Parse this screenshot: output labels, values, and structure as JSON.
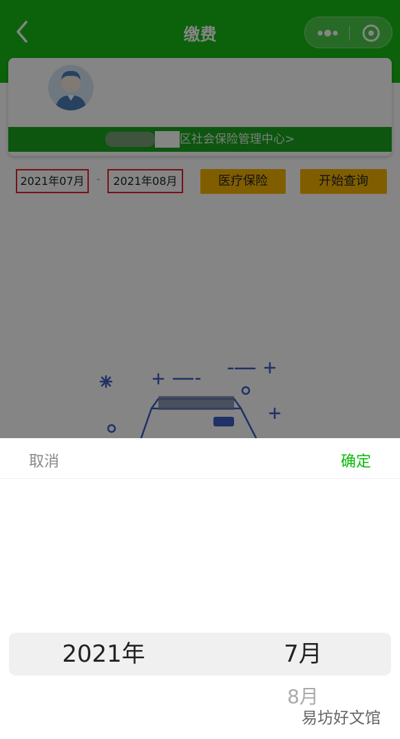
{
  "navbar": {
    "title": "缴费",
    "bg_color": "#16bd16",
    "icons": {
      "back": "chevron-left-icon",
      "more": "more-dots-icon",
      "close": "target-icon"
    }
  },
  "profile": {
    "org_text": "区社会保险管理中心>",
    "bar_color": "#19a51e"
  },
  "filter": {
    "start_date": "2021年07月",
    "separator": "-",
    "end_date": "2021年08月",
    "insurance_type": "医疗保险",
    "query_button": "开始查询",
    "button_color": "#f5b400",
    "highlight_color": "#e3202a"
  },
  "picker": {
    "cancel": "取消",
    "confirm": "确定",
    "confirm_color": "#09bb07",
    "year_selected": "2021年",
    "month_selected": "7月",
    "month_next": "8月"
  },
  "watermark": "易坊好文馆"
}
